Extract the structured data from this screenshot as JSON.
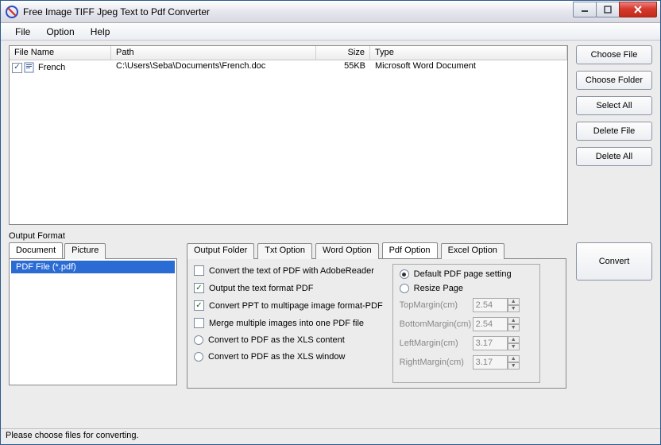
{
  "window": {
    "title": "Free Image TIFF Jpeg Text to Pdf Converter"
  },
  "menubar": {
    "file": "File",
    "option": "Option",
    "help": "Help"
  },
  "list": {
    "headers": {
      "name": "File Name",
      "path": "Path",
      "size": "Size",
      "type": "Type"
    },
    "row0": {
      "name": "French",
      "path": "C:\\Users\\Seba\\Documents\\French.doc",
      "size": "55KB",
      "type": "Microsoft Word Document"
    }
  },
  "sidebar": {
    "choose_file": "Choose File",
    "choose_folder": "Choose Folder",
    "select_all": "Select All",
    "delete_file": "Delete File",
    "delete_all": "Delete All"
  },
  "output_format_label": "Output Format",
  "fmt_tabs": {
    "document": "Document",
    "picture": "Picture"
  },
  "fmt_item": "PDF File  (*.pdf)",
  "opt_tabs": {
    "output_folder": "Output Folder",
    "txt": "Txt Option",
    "word": "Word Option",
    "pdf": "Pdf Option",
    "excel": "Excel Option"
  },
  "pdf": {
    "cb1": "Convert the text of PDF with AdobeReader",
    "cb2": "Output the text format PDF",
    "cb3": "Convert PPT to multipage image format-PDF",
    "cb4": "Merge multiple images into one PDF file",
    "rb1": "Convert to PDF as the XLS content",
    "rb2": "Convert to PDF as the XLS window",
    "right_rb1": "Default PDF page setting",
    "right_rb2": "Resize Page",
    "margins": {
      "top_l": "TopMargin(cm)",
      "top_v": "2.54",
      "bot_l": "BottomMargin(cm)",
      "bot_v": "2.54",
      "left_l": "LeftMargin(cm)",
      "left_v": "3.17",
      "right_l": "RightMargin(cm)",
      "right_v": "3.17"
    }
  },
  "convert": "Convert",
  "status": "Please choose files for converting."
}
